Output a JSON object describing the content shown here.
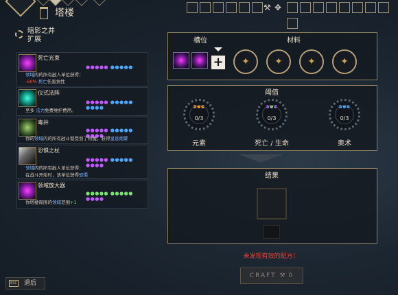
{
  "header": {
    "title": "塔楼",
    "icons": [
      "hammer-icon",
      "gear-cluster-icon"
    ]
  },
  "well": {
    "name": "暗影之井",
    "subtitle": "扩展"
  },
  "items": [
    {
      "name": "死亡光束",
      "icon": "death-beam-icon",
      "line1_hl": "领域",
      "line1": "内的所有敌人单位获得：",
      "line2_value": "-50%",
      "line2_hl": "死亡",
      "line2": "伤害抗性"
    },
    {
      "name": "仪式法阵",
      "icon": "ritual-circle-icon",
      "line1_pre": "至多",
      "line1_hl": "法力",
      "line1": "免费维护费用。"
    },
    {
      "name": "毒井",
      "icon": "poison-well-icon",
      "line1_pre": "你的",
      "line1_hl": "领域",
      "line1": "内的所有敌斗都受到了附魔，获得",
      "line1_hl2": "皇息烟雾"
    },
    {
      "name": "恐惧之杖",
      "icon": "fear-rod-icon",
      "line1_hl": "领域",
      "line1": "内的所有敌人单位获得：",
      "line2_pre": "在战斗开始时，该单位获得",
      "line2_hl": "恐惧"
    },
    {
      "name": "领域放大器",
      "icon": "domain-amplifier-icon",
      "line1_pre": "你塔楼周围的",
      "line1_hl": "领域",
      "line1": "范围",
      "line1_value": "+1"
    }
  ],
  "slots_panel": {
    "slot_label": "槽位",
    "material_label": "材料"
  },
  "threshold_panel": {
    "title": "阈值",
    "thresholds": [
      {
        "label": "元素",
        "value": "0/3"
      },
      {
        "label": "死亡 / 生命",
        "value": "0/3"
      },
      {
        "label": "奥术",
        "value": "0/3"
      }
    ]
  },
  "result_panel": {
    "title": "结果"
  },
  "warning": "未发现有效的配方！",
  "craft": {
    "label": "CRAFT",
    "count": "0"
  },
  "back": {
    "key": "ESC",
    "label": "退后"
  },
  "colors": {
    "accent": "#b5a27a",
    "highlight": "#7fb6ff",
    "danger": "#e0443a",
    "purple": "#c05cff",
    "blue": "#4aa8ff",
    "green": "#78e070",
    "orange": "#ff9a2a"
  }
}
